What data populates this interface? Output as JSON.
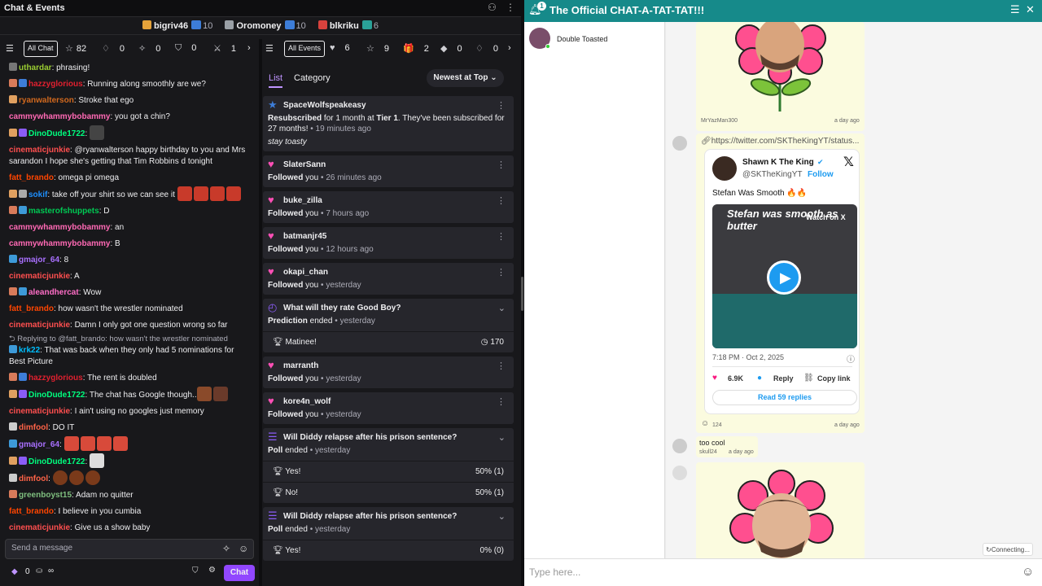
{
  "left_app": {
    "title": "Chat & Events",
    "viewers": [
      {
        "name": "bigriv46",
        "badge_color": "#e5a23a"
      },
      {
        "count": "10",
        "badge_color": "#3d7dd8"
      },
      {
        "name": "Oromoney",
        "badge_color": "#9aa0a6"
      },
      {
        "count": "10",
        "badge_color": "#3d7dd8"
      },
      {
        "name": "blkriku",
        "badge_color": "#d8423d"
      },
      {
        "count": "6",
        "badge_color": "#2aa198"
      }
    ],
    "chat_filter": {
      "label": "All Chat",
      "stats": [
        "82",
        "0",
        "0",
        "0",
        "1"
      ]
    },
    "events_filter": {
      "label": "All Events",
      "stats": [
        "6",
        "9",
        "2",
        "0",
        "0"
      ]
    },
    "chat_messages": [
      {
        "user": "uthardar",
        "color": "#9acd32",
        "text": ": phrasing!"
      },
      {
        "user": "hazzyglorious",
        "color": "#e0202f",
        "text": ": Running along smoothly are we?"
      },
      {
        "user": "ryanwalterson",
        "color": "#d2691e",
        "text": ": Stroke that ego"
      },
      {
        "user": "cammywhammybobammy",
        "color": "#ff69b4",
        "text": ": you got a chin?"
      },
      {
        "user": "DinoDude1722",
        "color": "#00ff7f",
        "text": ":"
      },
      {
        "user": "cinematicjunkie",
        "color": "#ff4f4f",
        "text": ": @ryanwalterson happy birthday to you and Mrs sarandon I hope she's getting that Tim Robbins d tonight"
      },
      {
        "user": "fatt_brando",
        "color": "#ff4500",
        "text": ": omega pi omega"
      },
      {
        "user": "sokif",
        "color": "#1e90ff",
        "text": ": take off your shirt so we can see it"
      },
      {
        "user": "masterofshuppets",
        "color": "#00c853",
        "text": ": D"
      },
      {
        "user": "cammywhammybobammy",
        "color": "#ff69b4",
        "text": ": an"
      },
      {
        "user": "cammywhammybobammy",
        "color": "#ff69b4",
        "text": ": B"
      },
      {
        "user": "gmajor_64",
        "color": "#a970ff",
        "text": ": 8"
      },
      {
        "user": "cinematicjunkie",
        "color": "#ff4f4f",
        "text": ": A"
      },
      {
        "user": "aleandhercat",
        "color": "#ff6ec7",
        "text": ": Wow"
      },
      {
        "user": "fatt_brando",
        "color": "#ff4500",
        "text": ": how wasn't the wrestler nominated"
      },
      {
        "user": "cinematicjunkie",
        "color": "#ff4f4f",
        "text": ": Damn I only got one question wrong so far"
      },
      {
        "reply_to": "Replying to @fatt_brando: how wasn't the wrestler nominated"
      },
      {
        "user": "krk22",
        "color": "#00bfff",
        "text": ": That was back when they only had 5 nominations for Best Picture"
      },
      {
        "user": "hazzyglorious",
        "color": "#e0202f",
        "text": ": The rent is doubled"
      },
      {
        "user": "DinoDude1722",
        "color": "#00ff7f",
        "text": ": The chat has Google though.."
      },
      {
        "user": "cinematicjunkie",
        "color": "#ff4f4f",
        "text": ": I ain't using no googles just memory"
      },
      {
        "user": "dimfool",
        "color": "#ff6347",
        "text": ": DO IT"
      },
      {
        "user": "gmajor_64",
        "color": "#a970ff",
        "text": ":"
      },
      {
        "user": "DinoDude1722",
        "color": "#00ff7f",
        "text": ":"
      },
      {
        "user": "dimfool",
        "color": "#ff6347",
        "text": ":"
      },
      {
        "user": "greenboyst15",
        "color": "#7fbf7f",
        "text": ": Adam no quitter"
      },
      {
        "user": "fatt_brando",
        "color": "#ff4500",
        "text": ": I believe in you cumbia"
      },
      {
        "user": "cinematicjunkie",
        "color": "#ff4f4f",
        "text": ": Give us a show baby"
      }
    ],
    "chat_input_placeholder": "Send a message",
    "footer": {
      "points": "0",
      "infinity": "∞",
      "chat_button": "Chat"
    },
    "events_tabs": [
      "List",
      "Category"
    ],
    "sort": "Newest at Top",
    "events": [
      {
        "kind": "resub",
        "user": "SpaceWolfspeakeasy",
        "line1": "Resubscribed",
        "line1b": " for 1 month at ",
        "tier": "Tier 1",
        "line1c": ". They've been subscribed for 27 months!",
        "time": "19 minutes ago",
        "quote": "stay toasty"
      },
      {
        "kind": "follow",
        "user": "SlaterSann",
        "action": "Followed",
        "rest": " you",
        "time": "26 minutes ago"
      },
      {
        "kind": "follow",
        "user": "buke_zilla",
        "action": "Followed",
        "rest": " you",
        "time": "7 hours ago"
      },
      {
        "kind": "follow",
        "user": "batmanjr45",
        "action": "Followed",
        "rest": " you",
        "time": "12 hours ago"
      },
      {
        "kind": "follow",
        "user": "okapi_chan",
        "action": "Followed",
        "rest": " you",
        "time": "yesterday"
      },
      {
        "kind": "prediction",
        "title": "What will they rate Good Boy?",
        "action": "Prediction",
        "rest": " ended",
        "time": "yesterday",
        "option": "Matinee!",
        "count": "170"
      },
      {
        "kind": "follow",
        "user": "marranth",
        "action": "Followed",
        "rest": " you",
        "time": "yesterday"
      },
      {
        "kind": "follow",
        "user": "kore4n_wolf",
        "action": "Followed",
        "rest": " you",
        "time": "yesterday"
      },
      {
        "kind": "poll",
        "title": "Will Diddy relapse after his prison sentence?",
        "action": "Poll",
        "rest": " ended",
        "time": "yesterday",
        "options": [
          {
            "label": "Yes!",
            "pct": "50% (1)"
          },
          {
            "label": "No!",
            "pct": "50% (1)"
          }
        ]
      },
      {
        "kind": "poll",
        "title": "Will Diddy relapse after his prison sentence?",
        "action": "Poll",
        "rest": " ended",
        "time": "yesterday",
        "options": [
          {
            "label": "Yes!",
            "pct": "0% (0)"
          }
        ]
      }
    ]
  },
  "right_app": {
    "title": "The Official CHAT-A-TAT-TAT!!!",
    "notif_count": "1",
    "room_name": "Double Toasted",
    "messages": {
      "flower1": {
        "sender": "MrYazMan300",
        "time": "a day ago"
      },
      "link": {
        "url": "https://twitter.com/SKTheKingYT/status..."
      },
      "tweet": {
        "name": "Shawn K The King",
        "handle": "@SKTheKingYT",
        "follow": "Follow",
        "text": "Stefan Was Smooth 🔥🔥",
        "video_caption": "Stefan was smooth as butter",
        "watch": "Watch on X",
        "timestamp": "7:18 PM · Oct 2, 2025",
        "likes": "6.9K",
        "reply": "Reply",
        "copy": "Copy link",
        "read_replies": "Read 59 replies"
      },
      "tweet_meta": {
        "reaction_count": "124",
        "time": "a day ago"
      },
      "too_cool": {
        "text": "too cool",
        "sender": "skull24",
        "time": "a day ago"
      }
    },
    "input_placeholder": "Type here...",
    "connecting": "Connecting..."
  }
}
